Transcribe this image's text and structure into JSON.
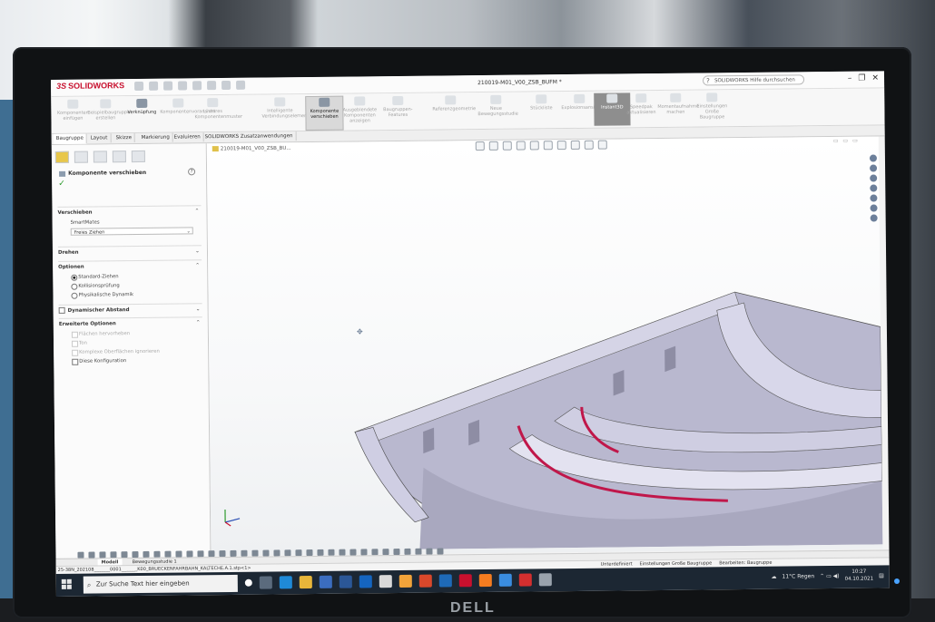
{
  "app": {
    "brand": "SOLIDWORKS",
    "brand_mark": "3S",
    "document_title": "210019-M01_V00_ZSB_BUFM *",
    "help_search_placeholder": "SOLIDWORKS Hilfe durchsuchen",
    "window_controls": [
      "–",
      "❐",
      "✕"
    ]
  },
  "ribbon": [
    {
      "label": "Komponenten einfügen",
      "state": "disabled"
    },
    {
      "label": "Beispielbaugruppe erstellen",
      "state": "disabled"
    },
    {
      "label": "Verknüpfung",
      "state": "enabled"
    },
    {
      "label": "Komponentenvoransicht",
      "state": "disabled"
    },
    {
      "label": "Lineares Komponentenmuster",
      "state": "disabled"
    },
    {
      "label": "Intelligente Verbindungselemente",
      "state": "disabled"
    },
    {
      "label": "Komponente verschieben",
      "state": "selected"
    },
    {
      "label": "Ausgeblendete Komponenten anzeigen",
      "state": "disabled"
    },
    {
      "label": "Baugruppen-Features",
      "state": "disabled"
    },
    {
      "label": "Referenzgeometrie",
      "state": "disabled"
    },
    {
      "label": "Neue Bewegungsstudie",
      "state": "disabled"
    },
    {
      "label": "Stückliste",
      "state": "disabled"
    },
    {
      "label": "Explosionsansicht",
      "state": "disabled"
    },
    {
      "label": "Instant3D",
      "state": "dark"
    },
    {
      "label": "Speedpak aktualisieren",
      "state": "disabled"
    },
    {
      "label": "Momentaufnahme machen",
      "state": "disabled"
    },
    {
      "label": "Einstellungen Große Baugruppe",
      "state": "disabled"
    }
  ],
  "command_tabs": [
    "Baugruppe",
    "Layout",
    "Skizze",
    "Markierung",
    "Evaluieren",
    "SOLIDWORKS Zusatzanwendungen"
  ],
  "property_manager": {
    "title": "Komponente verschieben",
    "help": "?",
    "ok": "✓",
    "sections": {
      "verschieben": {
        "header": "Verschieben",
        "smartmates": "SmartMates",
        "mode": "Freies Ziehen"
      },
      "drehen": {
        "header": "Drehen"
      },
      "optionen": {
        "header": "Optionen",
        "radios": [
          "Standard-Ziehen",
          "Kollisionsprüfung",
          "Physikalische Dynamik"
        ]
      },
      "dynamischer_abstand": {
        "header": "Dynamischer Abstand"
      },
      "erweiterte": {
        "header": "Erweiterte Optionen",
        "options": [
          "Flächen hervorheben",
          "Ton",
          "Komplexe Oberflächen ignorieren",
          "Diese Konfiguration"
        ]
      }
    }
  },
  "viewport": {
    "breadcrumb": "210019-M01_V00_ZSB_BU..."
  },
  "bottom_tabs": [
    "Modell",
    "Bewegungsstudie 1"
  ],
  "status_bar": {
    "file": "25-38N_202108_______0001_______K00_BRUECKENFAHRBAHN_KALTECHE.A.1.stp<1>",
    "items": [
      "Unterdefiniert",
      "Einstellungen Große Baugruppe",
      "Bearbeiten: Baugruppe"
    ]
  },
  "taskbar": {
    "search_placeholder": "Zur Suche Text hier eingeben",
    "weather": "11°C Regen",
    "time": "10:27",
    "date": "04.10.2021"
  },
  "monitor_brand": "DELL",
  "colors": {
    "brand_red": "#c8102e",
    "model_fill": "#b9b8cf",
    "highlight_edge": "#c0174a"
  }
}
